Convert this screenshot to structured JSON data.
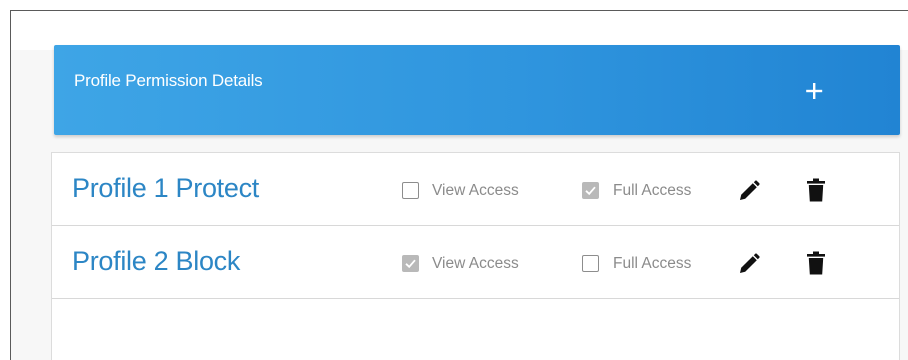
{
  "header": {
    "title": "Profile Permission Details",
    "add_icon": "plus-icon",
    "gradient_start": "#3ea5e6",
    "gradient_end": "#2184d3"
  },
  "profiles": [
    {
      "name": "Profile 1  Protect",
      "view_access": {
        "label": "View Access",
        "checked": false
      },
      "full_access": {
        "label": "Full Access",
        "checked": true
      },
      "edit_icon": "pencil-icon",
      "delete_icon": "trash-icon"
    },
    {
      "name": "Profile 2  Block",
      "view_access": {
        "label": "View Access",
        "checked": true
      },
      "full_access": {
        "label": "Full Access",
        "checked": false
      },
      "edit_icon": "pencil-icon",
      "delete_icon": "trash-icon"
    }
  ],
  "colors": {
    "profile_name": "#2c86c5",
    "checkbox_checked": "#b9b9b9",
    "label_text": "#8b8b8b"
  }
}
